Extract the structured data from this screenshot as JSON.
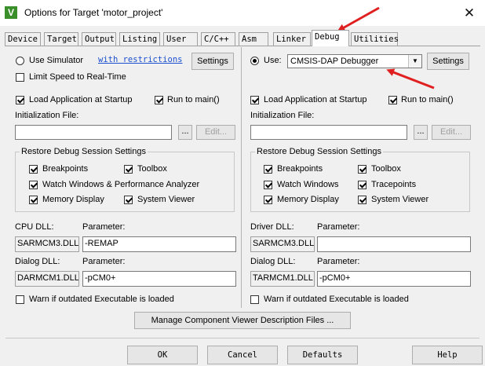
{
  "window": {
    "title": "Options for Target 'motor_project'",
    "close_glyph": "✕",
    "icon_letter": "V"
  },
  "tabs": [
    {
      "label": "Device"
    },
    {
      "label": "Target"
    },
    {
      "label": "Output"
    },
    {
      "label": "Listing"
    },
    {
      "label": "User"
    },
    {
      "label": "C/C++"
    },
    {
      "label": "Asm"
    },
    {
      "label": "Linker"
    },
    {
      "label": "Debug",
      "active": true
    },
    {
      "label": "Utilities"
    }
  ],
  "left": {
    "use_simulator": "Use Simulator",
    "restrictions_link": "with restrictions",
    "settings": "Settings",
    "limit_speed": "Limit Speed to Real-Time",
    "load_app": "Load Application at Startup",
    "run_to_main": "Run to main()",
    "init_file_label": "Initialization File:",
    "init_file_value": "",
    "browse": "...",
    "edit": "Edit...",
    "restore_group": "Restore Debug Session Settings",
    "breakpoints": "Breakpoints",
    "toolbox": "Toolbox",
    "watch_windows": "Watch Windows & Performance Analyzer",
    "memory_display": "Memory Display",
    "system_viewer": "System Viewer",
    "cpu_dll_label": "CPU DLL:",
    "cpu_param_label": "Parameter:",
    "cpu_dll": "SARMCM3.DLL",
    "cpu_param": "-REMAP",
    "dialog_dll_label": "Dialog DLL:",
    "dialog_param_label": "Parameter:",
    "dialog_dll": "DARMCM1.DLL",
    "dialog_param": "-pCM0+",
    "warn": "Warn if outdated Executable is loaded"
  },
  "right": {
    "use": "Use:",
    "debugger": "CMSIS-DAP Debugger",
    "settings": "Settings",
    "load_app": "Load Application at Startup",
    "run_to_main": "Run to main()",
    "init_file_label": "Initialization File:",
    "init_file_value": "",
    "browse": "...",
    "edit": "Edit...",
    "restore_group": "Restore Debug Session Settings",
    "breakpoints": "Breakpoints",
    "toolbox": "Toolbox",
    "watch_windows": "Watch Windows",
    "tracepoints": "Tracepoints",
    "memory_display": "Memory Display",
    "system_viewer": "System Viewer",
    "driver_dll_label": "Driver DLL:",
    "driver_param_label": "Parameter:",
    "driver_dll": "SARMCM3.DLL",
    "driver_param": "",
    "dialog_dll_label": "Dialog DLL:",
    "dialog_param_label": "Parameter:",
    "dialog_dll": "TARMCM1.DLL",
    "dialog_param": "-pCM0+",
    "warn": "Warn if outdated Executable is loaded"
  },
  "manage_button": "Manage Component Viewer Description Files ...",
  "footer": {
    "ok": "OK",
    "cancel": "Cancel",
    "defaults": "Defaults",
    "help": "Help"
  },
  "colors": {
    "annotation_arrow": "#e02020",
    "link": "#1a4fd0",
    "accent": "#3a8f2a"
  }
}
